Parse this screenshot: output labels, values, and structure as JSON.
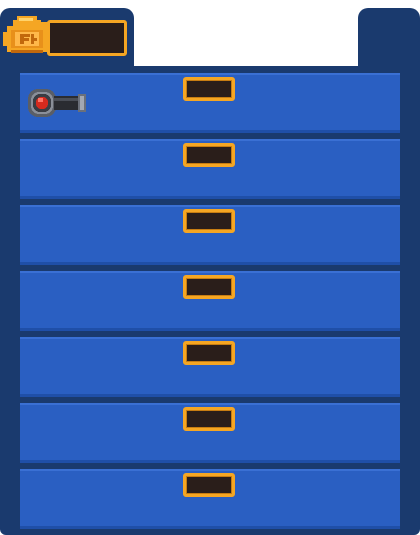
{
  "hud": {
    "coin_icon": "coin-stack-icon",
    "coin_count": ""
  },
  "colors": {
    "cabinet": "#1a3a6e",
    "drawer": "#2a5fc2",
    "handle_border": "#f5a623",
    "handle_fill": "#2a1e1a"
  },
  "drawers": [
    {
      "item": "bomb-cannon-icon"
    },
    {
      "item": ""
    },
    {
      "item": ""
    },
    {
      "item": ""
    },
    {
      "item": ""
    },
    {
      "item": ""
    },
    {
      "item": ""
    }
  ]
}
